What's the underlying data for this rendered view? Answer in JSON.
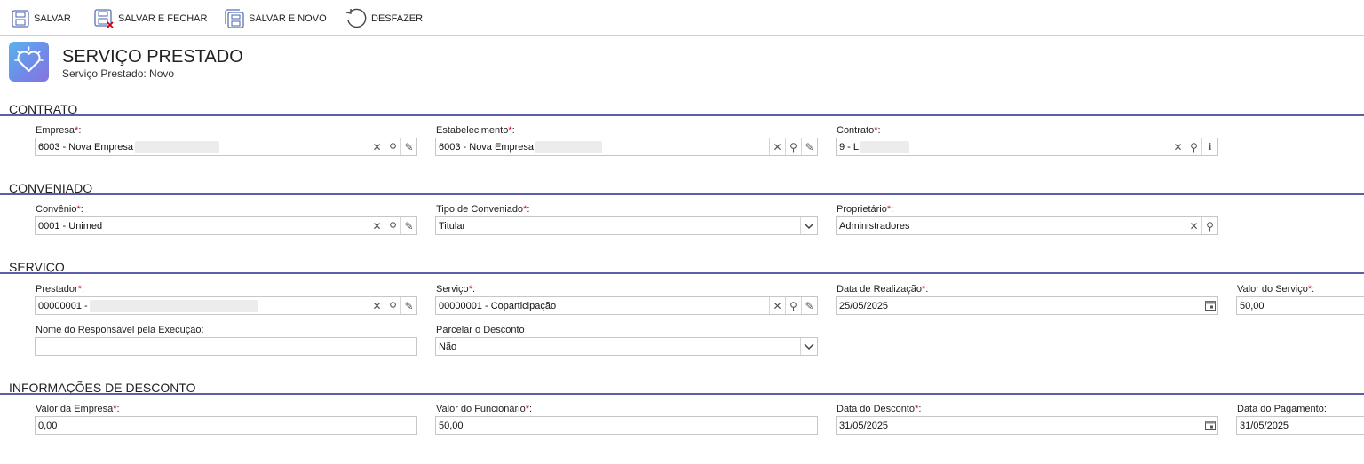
{
  "toolbar": {
    "save_label": "SALVAR",
    "save_close_label": "SALVAR E FECHAR",
    "save_new_label": "SALVAR E NOVO",
    "undo_label": "DESFAZER"
  },
  "header": {
    "title": "SERVIÇO PRESTADO",
    "subtitle": "Serviço Prestado: Novo"
  },
  "required_mark": "*",
  "sections": {
    "contrato": {
      "title": "CONTRATO",
      "empresa": {
        "label": "Empresa",
        "colon": ":",
        "value": "6003 - Nova Empresa"
      },
      "estabelecimento": {
        "label": "Estabelecimento",
        "colon": ":",
        "value": "6003 - Nova Empresa"
      },
      "contrato": {
        "label": "Contrato",
        "colon": ":",
        "value": "9 - L"
      }
    },
    "conveniado": {
      "title": "CONVENIADO",
      "convenio": {
        "label": "Convênio",
        "colon": ":",
        "value": "0001 - Unimed"
      },
      "tipo": {
        "label": "Tipo de Conveniado",
        "colon": ":",
        "value": "Titular"
      },
      "proprietario": {
        "label": "Proprietário",
        "colon": ":",
        "value": "Administradores"
      }
    },
    "servico": {
      "title": "SERVIÇO",
      "prestador": {
        "label": "Prestador",
        "colon": ":",
        "value": "00000001 -"
      },
      "servico": {
        "label": "Serviço",
        "colon": ":",
        "value": "00000001 - Coparticipação"
      },
      "data_realizacao": {
        "label": "Data de Realização",
        "colon": ":",
        "value": "25/05/2025"
      },
      "valor_servico": {
        "label": "Valor do Serviço",
        "colon": ":",
        "value": "50,00"
      },
      "responsavel": {
        "label": "Nome do Responsável pela Execução:",
        "value": ""
      },
      "parcelar": {
        "label": "Parcelar o Desconto",
        "value": "Não"
      }
    },
    "desconto": {
      "title": "INFORMAÇÕES DE DESCONTO",
      "valor_empresa": {
        "label": "Valor da Empresa",
        "colon": ":",
        "value": "0,00"
      },
      "valor_funcionario": {
        "label": "Valor do Funcionário",
        "colon": ":",
        "value": "50,00"
      },
      "data_desconto": {
        "label": "Data do Desconto",
        "colon": ":",
        "value": "31/05/2025"
      },
      "data_pagamento": {
        "label": "Data do Pagamento:",
        "value": "31/05/2025"
      }
    }
  },
  "colors": {
    "section_line": "#5a5fa8",
    "required": "#d0021b",
    "header_icon_gradient": [
      "#5ab2ee",
      "#8a72df"
    ]
  },
  "icons": [
    "save-icon",
    "save-close-icon",
    "save-new-icon",
    "undo-icon",
    "heart-icon",
    "clear-icon",
    "search-icon",
    "edit-icon",
    "info-icon",
    "chevron-down-icon",
    "calendar-icon"
  ]
}
